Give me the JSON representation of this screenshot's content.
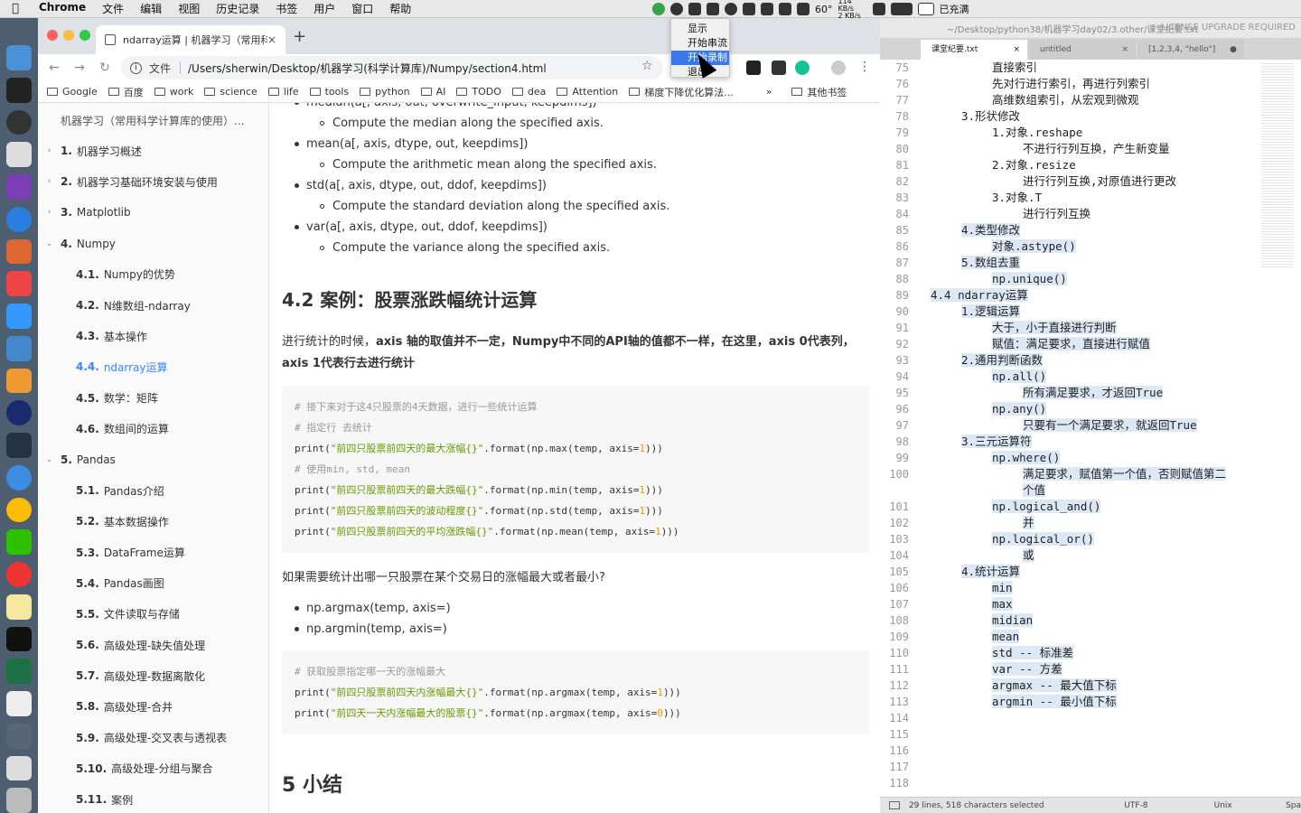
{
  "menubar": {
    "apple": "",
    "items": [
      "Chrome",
      "文件",
      "编辑",
      "视图",
      "历史记录",
      "书签",
      "用户",
      "窗口",
      "帮助"
    ],
    "tray": {
      "temp": "60°",
      "net_up": "114 KB/s",
      "net_down": "2 KB/s",
      "battery": "已充满"
    }
  },
  "context_menu": {
    "items": [
      "显示",
      "开始串流",
      "开始录制",
      "退出"
    ],
    "highlighted_index": 2
  },
  "chrome": {
    "tab_title": "ndarray运算 | 机器学习（常用科",
    "new_tab": "+",
    "omnibox_label": "文件",
    "url": "/Users/sherwin/Desktop/机器学习(科学计算库)/Numpy/section4.html",
    "bookmarks": [
      "Google",
      "百度",
      "work",
      "science",
      "life",
      "tools",
      "python",
      "AI",
      "TODO",
      "dea",
      "Attention",
      "梯度下降优化算法..."
    ],
    "bookmarks_more": "»",
    "bookmarks_other": "其他书签"
  },
  "sidebar": {
    "head": "机器学习（常用科学计算库的使用）...",
    "items": [
      {
        "num": "1.",
        "label": "机器学习概述",
        "level": 1,
        "chev": "›"
      },
      {
        "num": "2.",
        "label": "机器学习基础环境安装与使用",
        "level": 1,
        "chev": "›"
      },
      {
        "num": "3.",
        "label": "Matplotlib",
        "level": 1,
        "chev": "›"
      },
      {
        "num": "4.",
        "label": "Numpy",
        "level": 1,
        "chev": "⌄"
      },
      {
        "num": "4.1.",
        "label": "Numpy的优势",
        "level": 2
      },
      {
        "num": "4.2.",
        "label": "N维数组-ndarray",
        "level": 2
      },
      {
        "num": "4.3.",
        "label": "基本操作",
        "level": 2
      },
      {
        "num": "4.4.",
        "label": "ndarray运算",
        "level": 2,
        "active": true
      },
      {
        "num": "4.5.",
        "label": "数学：矩阵",
        "level": 2
      },
      {
        "num": "4.6.",
        "label": "数组间的运算",
        "level": 2
      },
      {
        "num": "5.",
        "label": "Pandas",
        "level": 1,
        "chev": "⌄"
      },
      {
        "num": "5.1.",
        "label": "Pandas介绍",
        "level": 2
      },
      {
        "num": "5.2.",
        "label": "基本数据操作",
        "level": 2
      },
      {
        "num": "5.3.",
        "label": "DataFrame运算",
        "level": 2
      },
      {
        "num": "5.4.",
        "label": "Pandas画图",
        "level": 2
      },
      {
        "num": "5.5.",
        "label": "文件读取与存储",
        "level": 2
      },
      {
        "num": "5.6.",
        "label": "高级处理-缺失值处理",
        "level": 2
      },
      {
        "num": "5.7.",
        "label": "高级处理-数据离散化",
        "level": 2
      },
      {
        "num": "5.8.",
        "label": "高级处理-合并",
        "level": 2
      },
      {
        "num": "5.9.",
        "label": "高级处理-交叉表与透视表",
        "level": 2
      },
      {
        "num": "5.10.",
        "label": "高级处理-分组与聚合",
        "level": 2
      },
      {
        "num": "5.11.",
        "label": "案例",
        "level": 2
      }
    ]
  },
  "content": {
    "list": [
      {
        "fn": "median(a[, axis, out, overwrite_input, keepdims])",
        "desc": "Compute the median along the specified axis."
      },
      {
        "fn": "mean(a[, axis, dtype, out, keepdims])",
        "desc": "Compute the arithmetic mean along the specified axis."
      },
      {
        "fn": "std(a[, axis, dtype, out, ddof, keepdims])",
        "desc": "Compute the standard deviation along the specified axis."
      },
      {
        "fn": "var(a[, axis, dtype, out, ddof, keepdims])",
        "desc": "Compute the variance along the specified axis."
      }
    ],
    "h2": "4.2 案例：股票涨跌幅统计运算",
    "para_pre": "进行统计的时候，",
    "para_b1": "axis 轴的取值并不一定，Numpy中不同的API轴的值都不一样，在这里，axis 0代表列，axis 1代表行去进行统计",
    "code1": [
      {
        "t": "cm",
        "text": "# 接下来对于这4只股票的4天数据，进行一些统计运算"
      },
      {
        "t": "cm",
        "text": "# 指定行 去统计"
      },
      {
        "t": "code",
        "pre": "print(",
        "str": "\"前四只股票前四天的最大涨幅{}\"",
        "mid": ".format(np.max(temp, axis=",
        "num": "1",
        "post": ")))"
      },
      {
        "t": "cm",
        "text": "# 使用min, std, mean"
      },
      {
        "t": "code",
        "pre": "print(",
        "str": "\"前四只股票前四天的最大跌幅{}\"",
        "mid": ".format(np.min(temp, axis=",
        "num": "1",
        "post": ")))"
      },
      {
        "t": "code",
        "pre": "print(",
        "str": "\"前四只股票前四天的波动程度{}\"",
        "mid": ".format(np.std(temp, axis=",
        "num": "1",
        "post": ")))"
      },
      {
        "t": "code",
        "pre": "print(",
        "str": "\"前四只股票前四天的平均涨跌幅{}\"",
        "mid": ".format(np.mean(temp, axis=",
        "num": "1",
        "post": ")))"
      }
    ],
    "question": "如果需要统计出哪一只股票在某个交易日的涨幅最大或者最小?",
    "list2": [
      "np.argmax(temp, axis=)",
      "np.argmin(temp, axis=)"
    ],
    "code2": [
      {
        "t": "cm",
        "text": "# 获取股票指定哪一天的涨幅最大"
      },
      {
        "t": "code",
        "pre": "print(",
        "str": "\"前四只股票前四天内涨幅最大{}\"",
        "mid": ".format(np.argmax(temp, axis=",
        "num": "1",
        "post": ")))"
      },
      {
        "t": "code",
        "pre": "print(",
        "str": "\"前四天一天内涨幅最大的股票{}\"",
        "mid": ".format(np.argmax(temp, axis=",
        "num": "0",
        "post": ")))"
      }
    ],
    "h2b": "5 小结"
  },
  "editor": {
    "title": "~/Desktop/python38/机器学习day02/3.other/课堂纪要.txt",
    "license": "LICENSE UPGRADE REQUIRED",
    "tabs": [
      {
        "label": "课堂纪要.txt",
        "x": "×"
      },
      {
        "label": "untitled",
        "x": "×"
      },
      {
        "label": "[1,2,3,4, \"hello\"]",
        "x": "●"
      }
    ],
    "lines": [
      {
        "n": "75",
        "ind": 2,
        "text": "直接索引"
      },
      {
        "n": "76",
        "ind": 2,
        "text": "先对行进行索引，再进行列索引"
      },
      {
        "n": "77",
        "ind": 2,
        "text": "高维数组索引，从宏观到微观"
      },
      {
        "n": "78",
        "ind": 1,
        "text": "3.形状修改"
      },
      {
        "n": "79",
        "ind": 2,
        "text": "1.对象.reshape"
      },
      {
        "n": "80",
        "ind": 3,
        "text": "不进行行列互换，产生新变量"
      },
      {
        "n": "81",
        "ind": 2,
        "text": "2.对象.resize"
      },
      {
        "n": "82",
        "ind": 3,
        "text": "进行行列互换,对原值进行更改"
      },
      {
        "n": "83",
        "ind": 2,
        "text": "3.对象.T"
      },
      {
        "n": "84",
        "ind": 3,
        "text": "进行行列互换"
      },
      {
        "n": "85",
        "ind": 1,
        "text": "4.类型修改",
        "sel": true
      },
      {
        "n": "86",
        "ind": 2,
        "text": "对象.astype()",
        "sel": true
      },
      {
        "n": "87",
        "ind": 1,
        "text": "5.数组去重",
        "sel": true
      },
      {
        "n": "88",
        "ind": 2,
        "text": "np.unique()",
        "sel": true
      },
      {
        "n": "89",
        "ind": 0,
        "text": "4.4 ndarray运算",
        "sel": true
      },
      {
        "n": "90",
        "ind": 1,
        "text": "1.逻辑运算",
        "sel": true
      },
      {
        "n": "91",
        "ind": 2,
        "text": "大于，小于直接进行判断",
        "sel": true
      },
      {
        "n": "92",
        "ind": 2,
        "text": "赋值：满足要求，直接进行赋值",
        "sel": true
      },
      {
        "n": "93",
        "ind": 1,
        "text": "2.通用判断函数",
        "sel": true
      },
      {
        "n": "94",
        "ind": 2,
        "text": "np.all()",
        "sel": true
      },
      {
        "n": "95",
        "ind": 3,
        "text": "所有满足要求，才返回True",
        "sel": true
      },
      {
        "n": "96",
        "ind": 2,
        "text": "np.any()",
        "sel": true
      },
      {
        "n": "97",
        "ind": 3,
        "text": "只要有一个满足要求，就返回True",
        "sel": true
      },
      {
        "n": "98",
        "ind": 1,
        "text": "3.三元运算符",
        "sel": true
      },
      {
        "n": "99",
        "ind": 2,
        "text": "np.where()",
        "sel": true
      },
      {
        "n": "100",
        "ind": 3,
        "text": "满足要求，赋值第一个值，否则赋值第二",
        "sel": true
      },
      {
        "n": "",
        "ind": 3,
        "text": "个值",
        "sel": true
      },
      {
        "n": "101",
        "ind": 2,
        "text": "np.logical_and()",
        "sel": true
      },
      {
        "n": "102",
        "ind": 3,
        "text": "并",
        "sel": true
      },
      {
        "n": "103",
        "ind": 2,
        "text": "np.logical_or()",
        "sel": true
      },
      {
        "n": "104",
        "ind": 3,
        "text": "或",
        "sel": true
      },
      {
        "n": "105",
        "ind": 1,
        "text": "4.统计运算",
        "sel": true
      },
      {
        "n": "106",
        "ind": 2,
        "text": "min",
        "sel": true
      },
      {
        "n": "107",
        "ind": 2,
        "text": "max",
        "sel": true
      },
      {
        "n": "108",
        "ind": 2,
        "text": "midian",
        "sel": true
      },
      {
        "n": "109",
        "ind": 2,
        "text": "mean",
        "sel": true
      },
      {
        "n": "110",
        "ind": 2,
        "text": "std -- 标准差",
        "sel": true
      },
      {
        "n": "111",
        "ind": 2,
        "text": "var -- 方差",
        "sel": true
      },
      {
        "n": "112",
        "ind": 2,
        "text": "argmax -- 最大值下标",
        "sel": true
      },
      {
        "n": "113",
        "ind": 2,
        "text": "argmin -- 最小值下标",
        "sel": true
      },
      {
        "n": "114",
        "ind": 0,
        "text": ""
      },
      {
        "n": "115",
        "ind": 0,
        "text": ""
      },
      {
        "n": "116",
        "ind": 0,
        "text": ""
      },
      {
        "n": "117",
        "ind": 0,
        "text": ""
      },
      {
        "n": "118",
        "ind": 0,
        "text": ""
      }
    ],
    "status": "29 lines, 518 characters selected",
    "encoding": "UTF-8",
    "line_endings": "Unix",
    "syntax": "Spa"
  },
  "colors": {
    "accent": "#3884ff",
    "selection": "#dde8f7",
    "menu_highlight": "#3b78e7"
  }
}
